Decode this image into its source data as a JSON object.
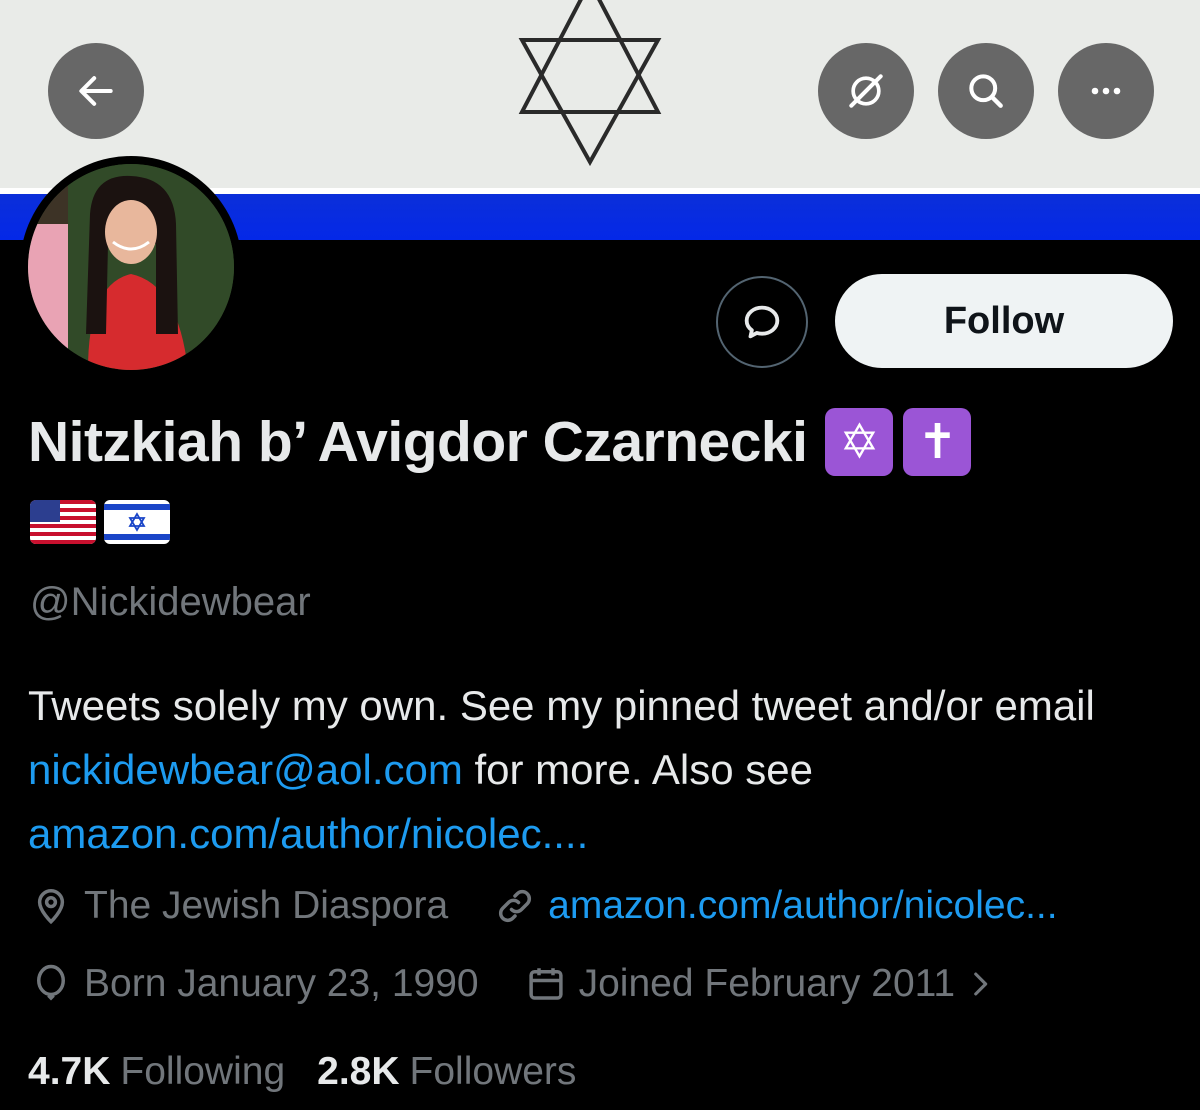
{
  "toolbar": {
    "back_icon": "arrow-left-icon",
    "grok_icon": "grok-icon",
    "search_icon": "search-icon",
    "more_icon": "more-horizontal-icon"
  },
  "banner": {
    "symbol": "star-of-david"
  },
  "actions": {
    "message_icon": "message-bubble-icon",
    "follow_label": "Follow"
  },
  "profile": {
    "display_name": "Nitzkiah b’ Avigdor Czarnecki",
    "name_emojis": [
      "✡",
      "✝"
    ],
    "flags": [
      "us-flag",
      "israel-flag"
    ],
    "handle": "@Nickidewbear",
    "bio": {
      "text_1": "Tweets solely my own. See my pinned tweet and/or email ",
      "email": "nickidewbear@aol.com",
      "text_2": " for more. Also see ",
      "link": "amazon.com/author/nicolec...."
    },
    "location": "The Jewish Diaspora",
    "website": "amazon.com/author/nicolec...",
    "birthday": "Born January 23, 1990",
    "joined": "Joined February 2011",
    "following_count": "4.7K",
    "following_label": "Following",
    "followers_count": "2.8K",
    "followers_label": "Followers"
  },
  "colors": {
    "background": "#000000",
    "accent_link": "#1d9bf0",
    "muted_text": "#71767b",
    "follow_bg": "#eff3f4",
    "emoji_purple": "#9b55d6",
    "banner_blue": "#0428e8"
  }
}
